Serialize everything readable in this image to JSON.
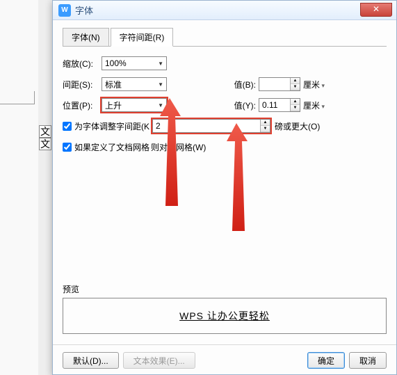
{
  "window": {
    "title": "字体"
  },
  "tabs": {
    "font": "字体(N)",
    "spacing": "字符间距(R)"
  },
  "form": {
    "scale_label": "缩放(C):",
    "scale_value": "100%",
    "spacing_label": "间距(S):",
    "spacing_value": "标准",
    "value_b_label": "值(B):",
    "value_b": "",
    "position_label": "位置(P):",
    "position_value": "上升",
    "value_y_label": "值(Y):",
    "value_y": "0.11",
    "unit": "厘米",
    "kerning_label": "为字体调整字间距(K",
    "kerning_value": "2",
    "kerning_suffix": "磅或更大(O)",
    "snap_label": "如果定义了文档网格",
    "snap_suffix": "则对齐网格(W)"
  },
  "preview": {
    "label": "预览",
    "text": "WPS 让办公更轻松"
  },
  "buttons": {
    "default": "默认(D)...",
    "text_effect": "文本效果(E)...",
    "ok": "确定",
    "cancel": "取消"
  },
  "side": {
    "c1": "文",
    "c2": "文"
  }
}
